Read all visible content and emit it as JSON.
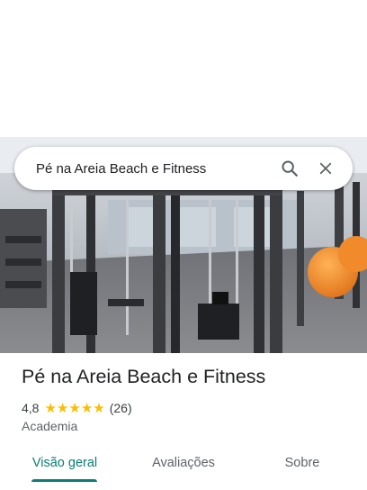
{
  "search": {
    "query": "Pé na Areia Beach e Fitness",
    "search_icon": "search-icon",
    "close_icon": "close-icon"
  },
  "hero": {
    "photo_icon": "gym-photo"
  },
  "place": {
    "name": "Pé na Areia Beach e Fitness",
    "rating": "4,8",
    "rating_value": 4.8,
    "stars_max": 5,
    "reviews": "(26)",
    "category": "Academia"
  },
  "tabs": [
    {
      "label": "Visão geral",
      "active": true
    },
    {
      "label": "Avaliações",
      "active": false
    },
    {
      "label": "Sobre",
      "active": false
    }
  ],
  "colors": {
    "accent": "#0b7d74",
    "star": "#fbbc04"
  }
}
